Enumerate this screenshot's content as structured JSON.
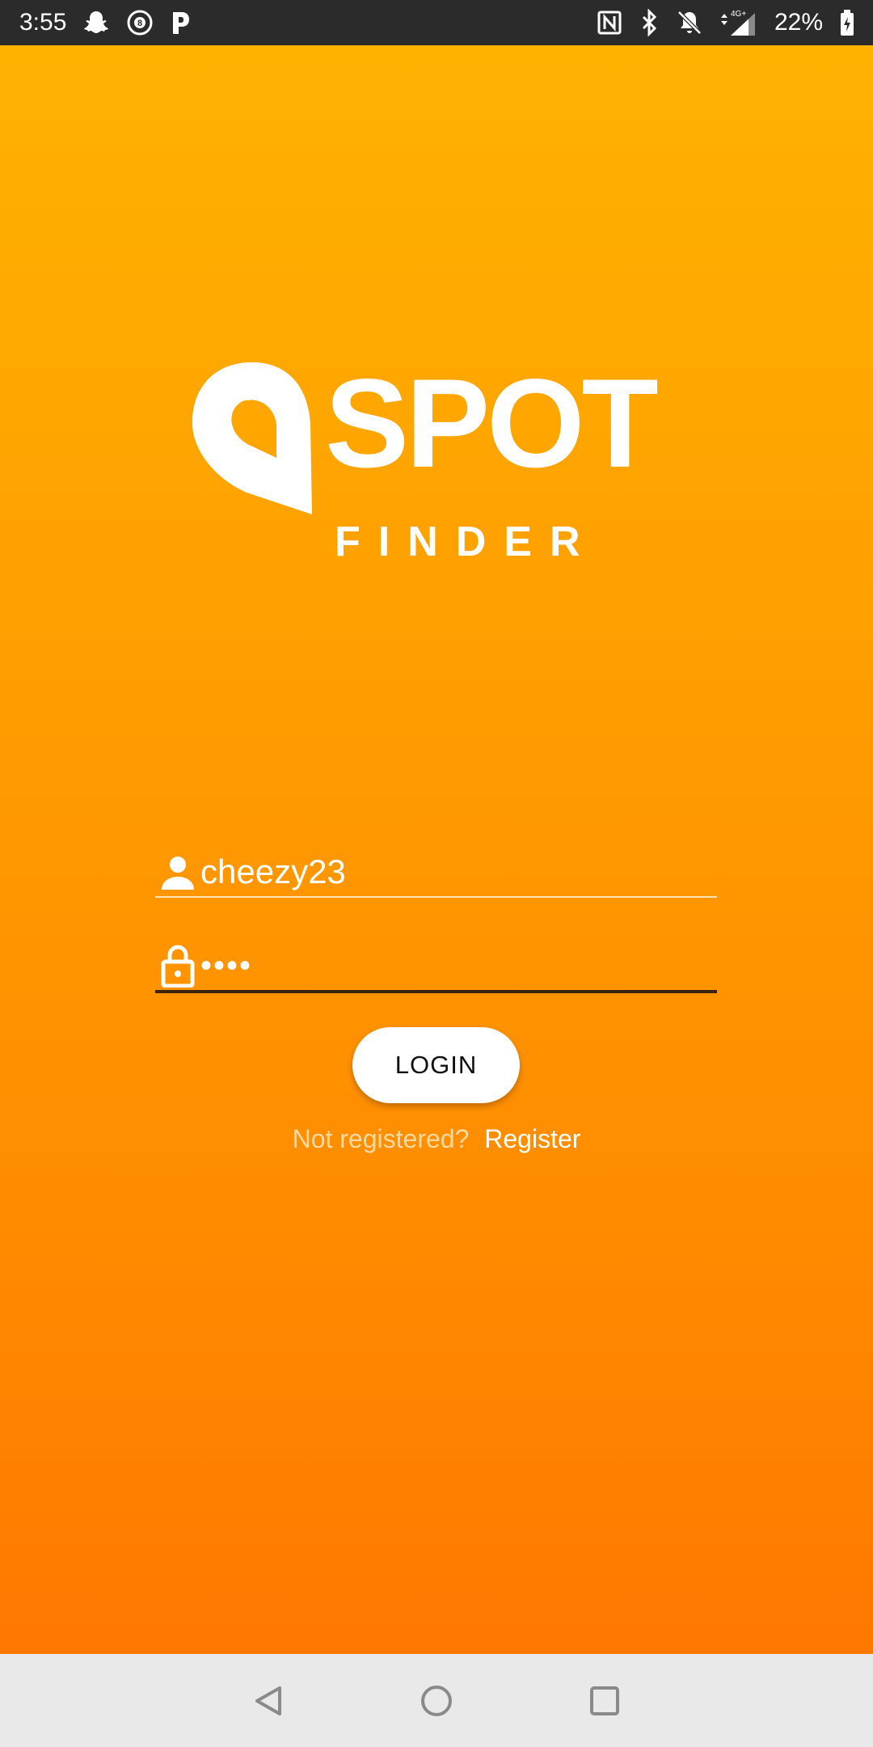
{
  "status_bar": {
    "time": "3:55",
    "left_icons": [
      "snapchat-icon",
      "8ball-icon",
      "pandora-icon"
    ],
    "right_icons": [
      "nfc-icon",
      "bluetooth-icon",
      "bell-off-icon",
      "signal-4g-icon",
      "battery-charging-icon"
    ],
    "network": "4G+",
    "battery": "22%"
  },
  "logo": {
    "wordmark": "SPOT",
    "subtitle": "FINDER",
    "icon": "map-pin-icon"
  },
  "login_form": {
    "username_icon": "person-icon",
    "username_value": "cheezy23",
    "password_icon": "lock-icon",
    "password_value": "••••",
    "login_label": "LOGIN"
  },
  "register": {
    "prompt": "Not registered?",
    "link_label": "Register"
  },
  "nav_bar": {
    "buttons": [
      "back-icon",
      "home-icon",
      "recents-icon"
    ]
  },
  "colors": {
    "gradient_top": "#ffb200",
    "gradient_bottom": "#ff7800",
    "status_bar": "#2b2b2b",
    "nav_bar": "#e9e9e9",
    "button_bg": "#ffffff"
  }
}
